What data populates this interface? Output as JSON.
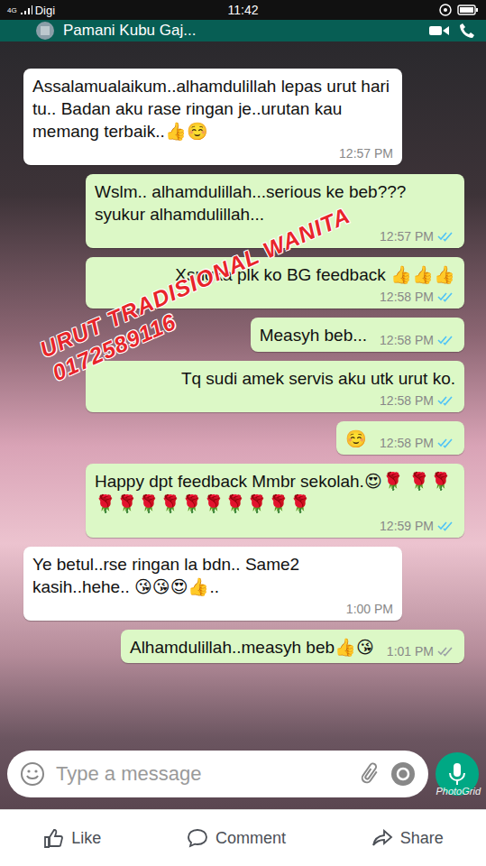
{
  "status_bar": {
    "carrier": "Digi",
    "network": "4G",
    "time": "11:42"
  },
  "chat_header": {
    "title": "Pamani Kubu Gaj..."
  },
  "messages": [
    {
      "kind": "incoming",
      "text": "Assalamualaikum..alhamdulillah lepas urut hari tu.. Badan aku rase ringan je..urutan kau memang terbaik..👍☺️",
      "time": "12:57 PM"
    },
    {
      "kind": "outgoing",
      "text": "Wslm.. alhamdulillah...serious ke beb??? syukur alhamdulillah...",
      "time": "12:57 PM",
      "read": true
    },
    {
      "kind": "outgoing",
      "text": "Xsngka plk ko BG feedback 👍👍👍",
      "time": "12:58 PM",
      "read": true
    },
    {
      "kind": "outgoing",
      "text": "Measyh beb...",
      "time": "12:58 PM",
      "read": true
    },
    {
      "kind": "outgoing",
      "text": "Tq sudi amek servis aku utk urut ko.",
      "time": "12:58 PM",
      "read": true
    },
    {
      "kind": "outgoing",
      "text": "☺️",
      "time": "12:58 PM",
      "read": true
    },
    {
      "kind": "outgoing",
      "text": "Happy dpt feedback Mmbr sekolah.😍🌹 🌹🌹🌹🌹🌹🌹🌹🌹🌹🌹🌹🌹",
      "time": "12:59 PM",
      "read": true
    },
    {
      "kind": "incoming",
      "text": "Ye betul..rse ringan la bdn.. Same2 kasih..hehe.. 😘😘😍👍..",
      "time": "1:00 PM"
    },
    {
      "kind": "outgoing",
      "text": "Alhamdulillah..measyh beb👍😘",
      "time": "1:01 PM",
      "read": false
    }
  ],
  "watermark": {
    "title": "URUT TRADISIONAL WANITA",
    "phone": "0172589116"
  },
  "input": {
    "placeholder": "Type a message"
  },
  "photogrid": "PhotoGrid",
  "actions": [
    {
      "label": "Like"
    },
    {
      "label": "Comment"
    },
    {
      "label": "Share"
    }
  ]
}
